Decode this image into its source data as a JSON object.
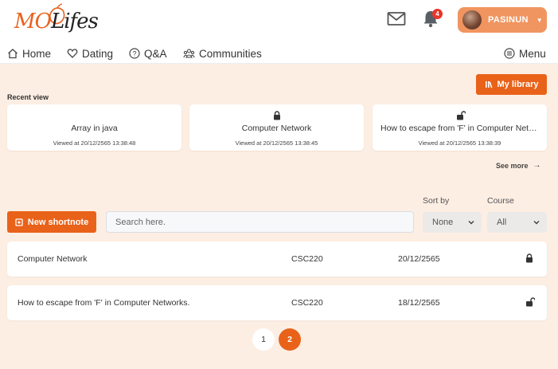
{
  "header": {
    "logo": {
      "part1": "MO",
      "part2": "Lifes"
    },
    "notifications_count": "4",
    "user": {
      "name": "PASINUN"
    }
  },
  "nav": {
    "items": [
      {
        "label": "Home",
        "icon": "home-icon"
      },
      {
        "label": "Dating",
        "icon": "heart-icon"
      },
      {
        "label": "Q&A",
        "icon": "question-icon"
      },
      {
        "label": "Communities",
        "icon": "communities-icon"
      }
    ],
    "menu_label": "Menu"
  },
  "library_button": "My library",
  "recent": {
    "label": "Recent view",
    "cards": [
      {
        "title": "Array in java",
        "time": "Viewed at 20/12/2565 13:38:48",
        "lock": "none"
      },
      {
        "title": "Computer Network",
        "time": "Viewed at 20/12/2565 13:38:45",
        "lock": "locked"
      },
      {
        "title": "How to escape from 'F' in Computer Networks.",
        "time": "Viewed at 20/12/2565 13:38:39",
        "lock": "unlocked"
      }
    ],
    "see_more": "See more"
  },
  "filters": {
    "sort_label": "Sort by",
    "sort_value": "None",
    "course_label": "Course",
    "course_value": "All"
  },
  "new_shortnote": "New shortnote",
  "search": {
    "placeholder": "Search here."
  },
  "notes": [
    {
      "title": "Computer Network",
      "course": "CSC220",
      "date": "20/12/2565",
      "lock": "locked"
    },
    {
      "title": "How to escape from 'F' in Computer Networks.",
      "course": "CSC220",
      "date": "18/12/2565",
      "lock": "unlocked"
    }
  ],
  "pagination": {
    "pages": [
      "1",
      "2"
    ],
    "current": "2"
  },
  "colors": {
    "accent": "#e9621a",
    "background": "#fdeee3",
    "badge": "#e8352b"
  }
}
